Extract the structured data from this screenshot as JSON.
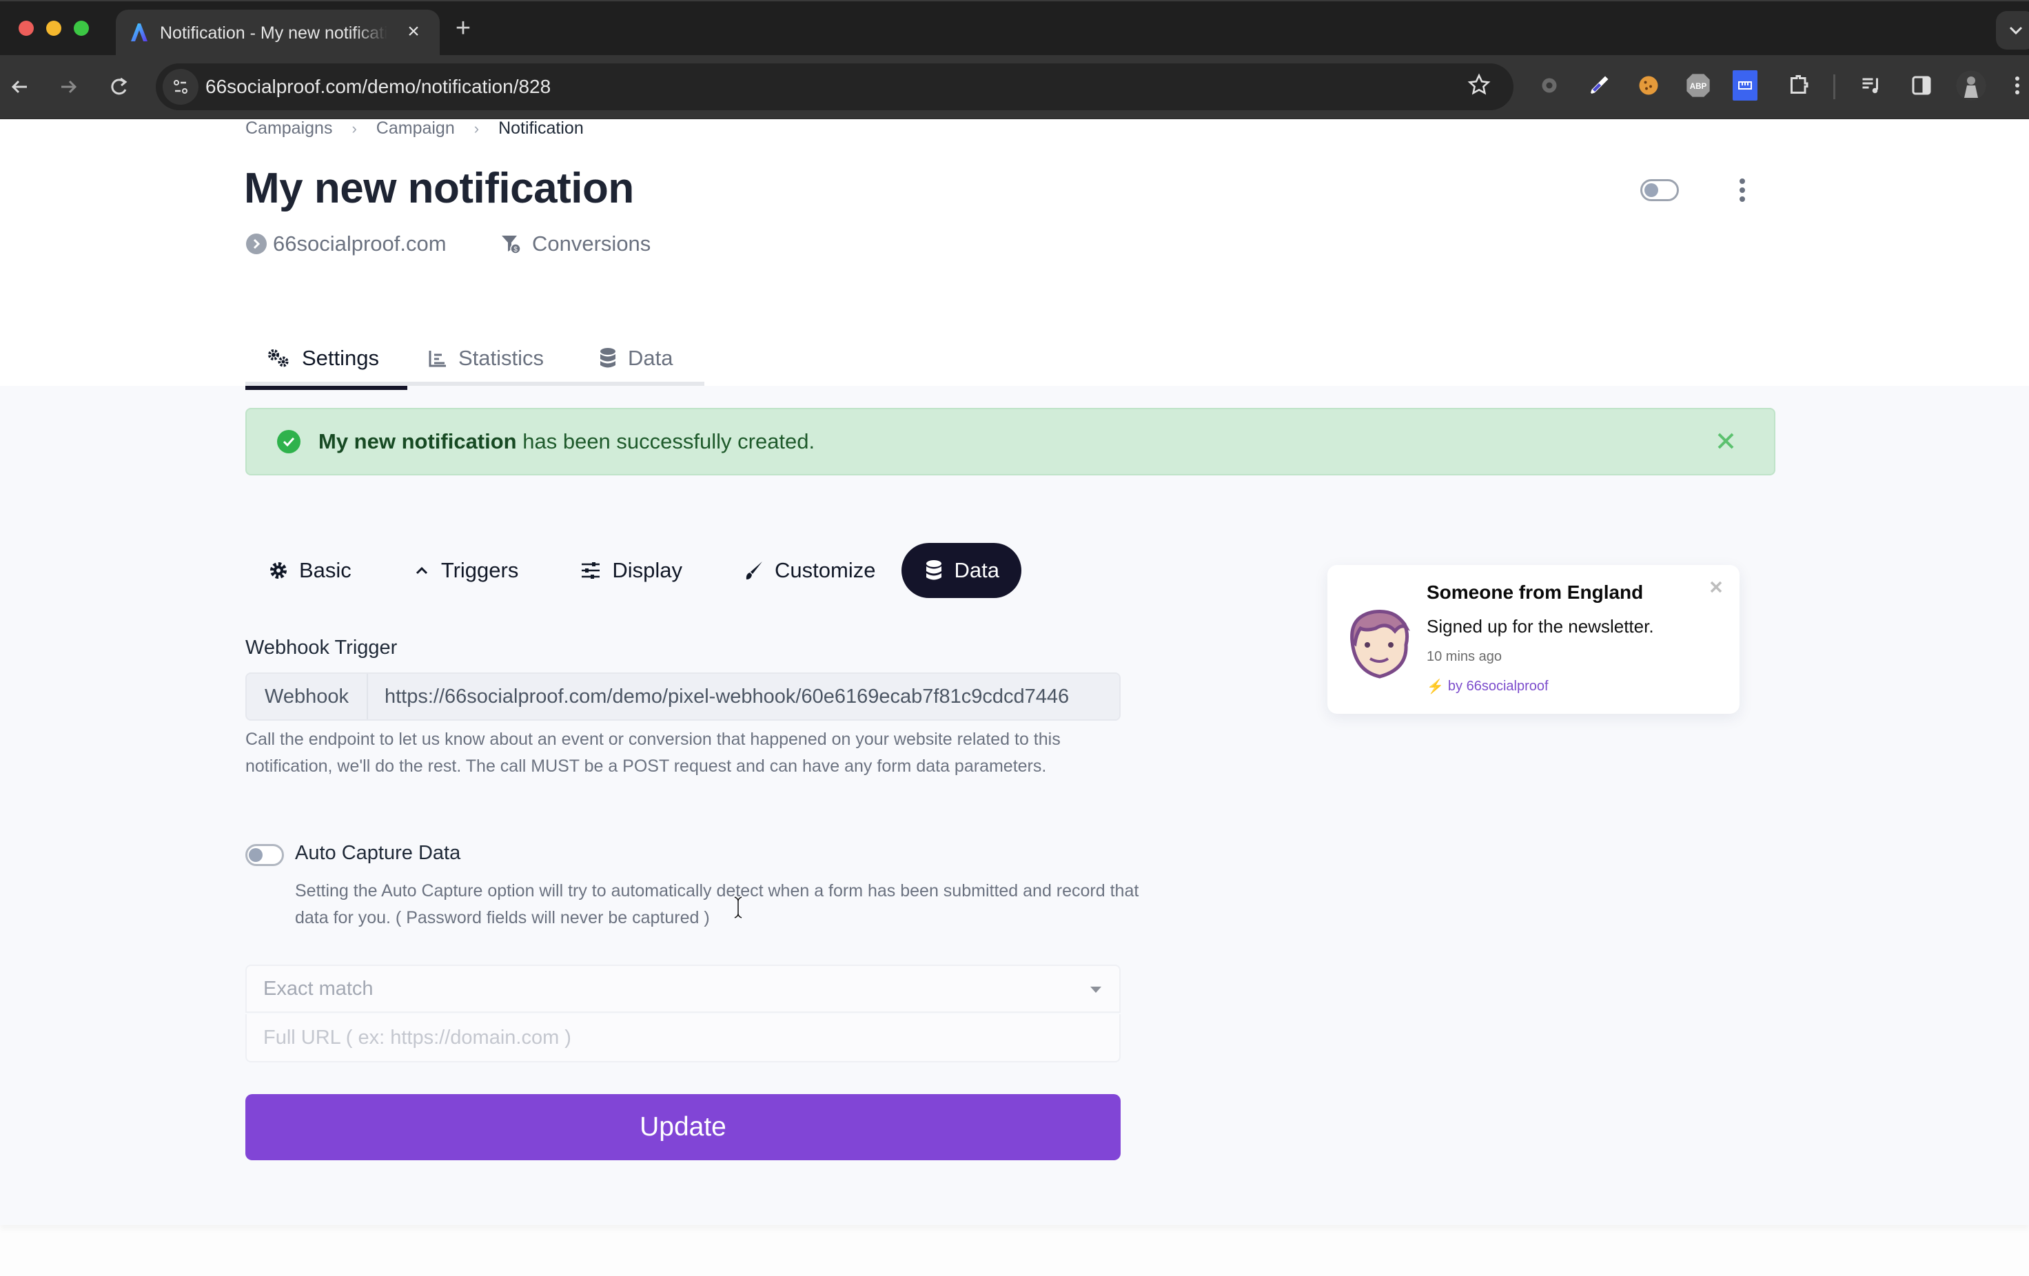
{
  "browser": {
    "tab_title": "Notification - My new notification",
    "tab_close": "×",
    "new_tab": "+",
    "url": "66socialproof.com/demo/notification/828",
    "extensions": [
      "puzzle-gear-icon",
      "eyedropper-icon",
      "cookie-icon",
      "adblock-plus-icon",
      "keyboard-icon",
      "extensions-puzzle-icon",
      "media-controls-icon",
      "side-panel-icon",
      "profile-avatar"
    ],
    "abp_label": "ABP"
  },
  "breadcrumb": [
    {
      "label": "Campaigns"
    },
    {
      "label": "Campaign"
    },
    {
      "label": "Notification"
    }
  ],
  "breadcrumb_separator": "›",
  "header": {
    "title": "My new notification",
    "domain": "66socialproof.com",
    "type": "Conversions",
    "enabled": false
  },
  "main_tabs": [
    {
      "label": "Settings",
      "icon": "cogs-icon",
      "active": true
    },
    {
      "label": "Statistics",
      "icon": "chart-bar-icon",
      "active": false
    },
    {
      "label": "Data",
      "icon": "database-icon",
      "active": false
    }
  ],
  "alert": {
    "bold": "My new notification",
    "text": " has been successfully created.",
    "colors": {
      "background": "#d1ecd8",
      "text": "#1e5a2b",
      "icon": "#2fb24c"
    }
  },
  "sub_tabs": [
    {
      "label": "Basic",
      "icon": "cog-icon",
      "active": false
    },
    {
      "label": "Triggers",
      "icon": "chevron-up-icon",
      "active": false
    },
    {
      "label": "Display",
      "icon": "sliders-icon",
      "active": false
    },
    {
      "label": "Customize",
      "icon": "paint-brush-icon",
      "active": false
    },
    {
      "label": "Data",
      "icon": "database-icon",
      "active": true
    }
  ],
  "form": {
    "webhook_label": "Webhook Trigger",
    "webhook_addon": "Webhook",
    "webhook_url": "https://66socialproof.com/demo/pixel-webhook/60e6169ecab7f81c9cdcd7446",
    "webhook_help": "Call the endpoint to let us know about an event or conversion that happened on your website related to this notification, we'll do the rest. The call MUST be a POST request and can have any form data parameters.",
    "auto_capture_label": "Auto Capture Data",
    "auto_capture_enabled": false,
    "auto_capture_help": "Setting the Auto Capture option will try to automatically detect when a form has been submitted and record that data for you. ( Password fields will never be captured )",
    "match_select_value": "Exact match",
    "url_placeholder": "Full URL ( ex: https://domain.com )",
    "url_value": "",
    "update_label": "Update",
    "accent_color": "#8145d6"
  },
  "preview": {
    "title": "Someone from England",
    "description": "Signed up for the newsletter.",
    "time": "10 mins ago",
    "brand_bolt": "⚡",
    "brand": "by 66socialproof"
  }
}
